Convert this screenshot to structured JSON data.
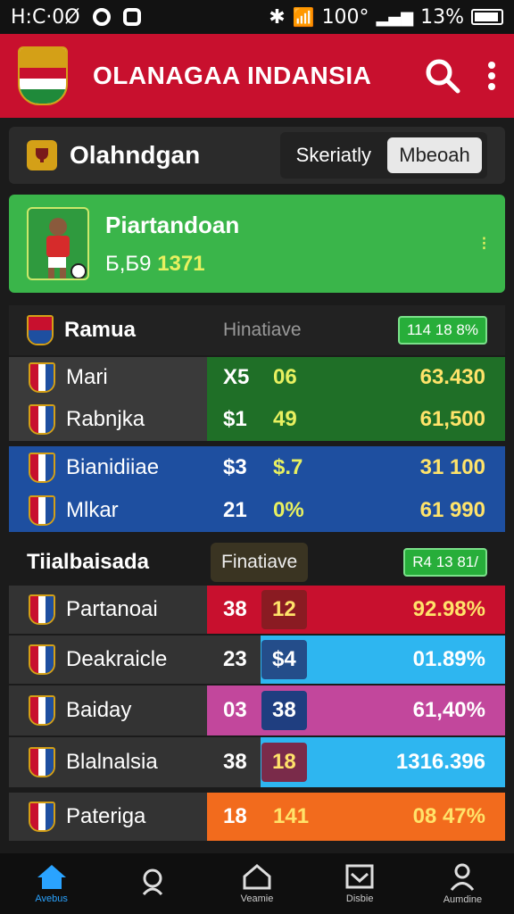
{
  "status_bar": {
    "time": "H:C·0Ø",
    "battery_text": "13%",
    "signal_text": "100°"
  },
  "app_bar": {
    "title": "OLANAGAA INDANSIA",
    "search_icon": "search-icon",
    "menu_icon": "more-vert-icon"
  },
  "filter_bar": {
    "title": "Olahndgan",
    "options": [
      "Skeriatly",
      "Mbeoah"
    ],
    "selected": "Mbeoah"
  },
  "featured": {
    "title": "Piartandoan",
    "value_prefix": "Б,Б9",
    "value": "1371"
  },
  "section_one": {
    "title": "Ramua",
    "column_label": "Hinatiave",
    "badge": "114 18 8%",
    "rows": [
      {
        "name": "Mari",
        "a": "X5",
        "b": "06",
        "c": "63.430",
        "band": "#1f6f27"
      },
      {
        "name": "Rabnjka",
        "a": "$1",
        "b": "49",
        "c": "61,500",
        "band": "#1f6f27"
      },
      {
        "name": "Bianidiiae",
        "a": "$3",
        "b": "$.7",
        "c": "31 100",
        "band": "#1e4fa0"
      },
      {
        "name": "Mlkar",
        "a": "21",
        "b": "0%",
        "c": "61 990",
        "band": "#1e4fa0"
      }
    ]
  },
  "section_two": {
    "title": "Tiialbaisada",
    "column_label": "Finatiave",
    "badge": "R4 13 81/",
    "rows": [
      {
        "name": "Partanoai",
        "a": "38",
        "b": "12",
        "c": "92.98%",
        "band": "#c8102e",
        "chip": "#8a1b22"
      },
      {
        "name": "Deakraicle",
        "a": "23",
        "b": "$4",
        "c": "01.89%",
        "band": "#2eb6f0",
        "chip": "#244d8a"
      },
      {
        "name": "Baiday",
        "a": "03",
        "b": "38",
        "c": "61,40%",
        "band": "#c2479c",
        "chip": "#1f3e80"
      },
      {
        "name": "Blalnalsia",
        "a": "38",
        "b": "18",
        "c": "1316.396",
        "band": "#2eb6f0",
        "chip": "#7a2b4a"
      },
      {
        "name": "Pateriga",
        "a": "18",
        "b": "141",
        "c": "08 47%",
        "band": "#f26b1d",
        "chip": ""
      }
    ]
  },
  "bottom_nav": [
    {
      "label": "Avebus",
      "icon": "home-icon"
    },
    {
      "label": "",
      "icon": "person-search-icon"
    },
    {
      "label": "Veamie",
      "icon": "house-outline-icon"
    },
    {
      "label": "Disbie",
      "icon": "inbox-icon"
    },
    {
      "label": "Aumdine",
      "icon": "profile-icon"
    }
  ]
}
